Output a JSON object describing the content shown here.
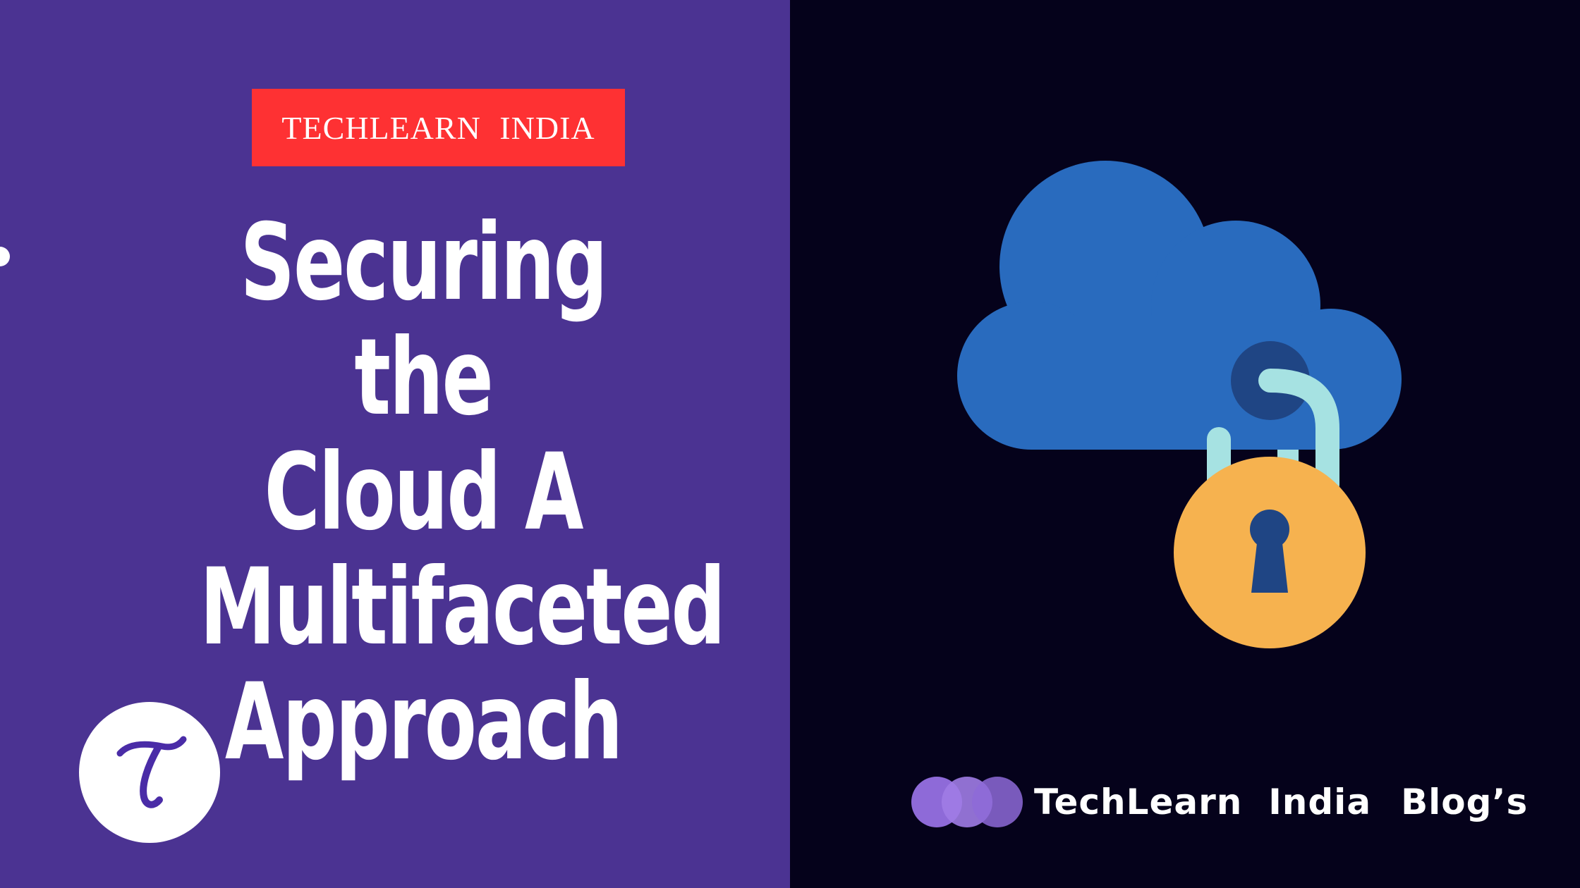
{
  "brand_badge": {
    "text": "TECHLEARN  INDIA"
  },
  "headline": {
    "lines": [
      "Securing the",
      "Cloud A",
      "Multifaceted",
      "Approach"
    ]
  },
  "logo": {
    "letter": "T",
    "icon": "techlearn-t-logo-icon"
  },
  "illustration": {
    "icon": "cloud-padlock-icon"
  },
  "footer": {
    "brand_name": "TechLearn  India",
    "suffix": "Blog’s"
  },
  "colors": {
    "left_background": "#4b3392",
    "right_background": "#05021b",
    "badge_red": "#fe3133",
    "cloud_blue": "#296bbe",
    "lock_orange": "#f6b24f",
    "shackle_cyan": "#a6e2e2",
    "keyhole_navy": "#1f4584"
  }
}
